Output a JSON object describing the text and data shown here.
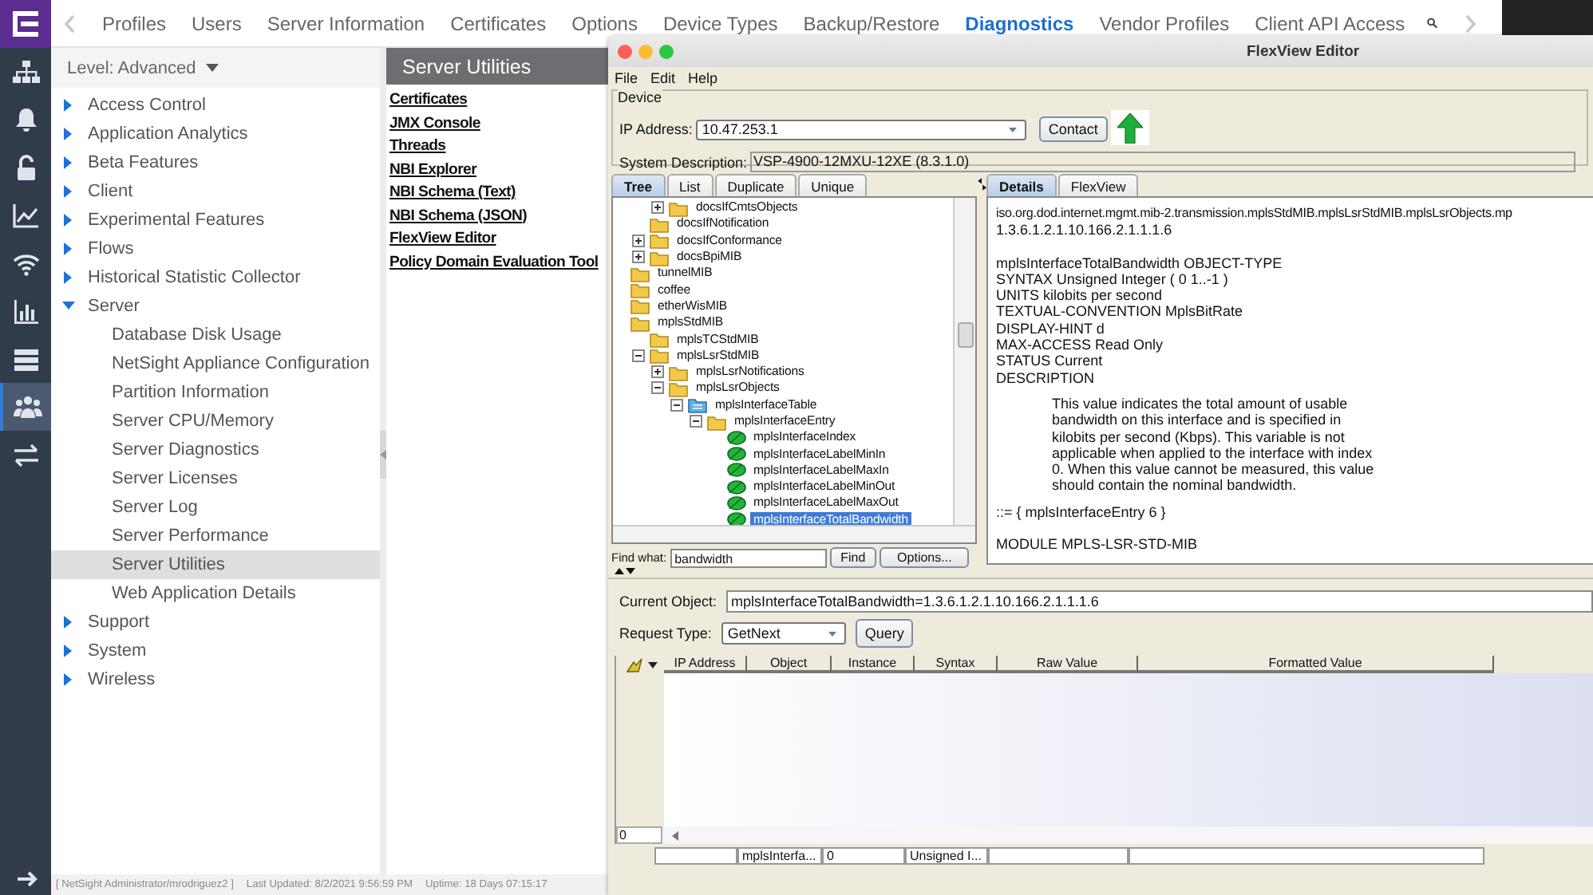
{
  "nav": {
    "items": [
      {
        "label": "Profiles",
        "selected": false
      },
      {
        "label": "Users",
        "selected": false
      },
      {
        "label": "Server Information",
        "selected": false
      },
      {
        "label": "Certificates",
        "selected": false
      },
      {
        "label": "Options",
        "selected": false
      },
      {
        "label": "Device Types",
        "selected": false
      },
      {
        "label": "Backup/Restore",
        "selected": false
      },
      {
        "label": "Diagnostics",
        "selected": true
      },
      {
        "label": "Vendor Profiles",
        "selected": false
      },
      {
        "label": "Client API Access",
        "selected": false
      }
    ]
  },
  "rail": [
    {
      "kind": "network",
      "selected": false
    },
    {
      "kind": "bell",
      "selected": false
    },
    {
      "kind": "lock",
      "selected": false
    },
    {
      "kind": "trend",
      "selected": false
    },
    {
      "kind": "wifi",
      "selected": false
    },
    {
      "kind": "bars",
      "selected": false
    },
    {
      "kind": "servers",
      "selected": false
    },
    {
      "kind": "users",
      "selected": true
    },
    {
      "kind": "exchange",
      "selected": false
    }
  ],
  "sidebar": {
    "level": "Level: Advanced",
    "items": [
      {
        "label": "Access Control",
        "expanded": false,
        "selected": false
      },
      {
        "label": "Application Analytics",
        "expanded": false,
        "selected": false
      },
      {
        "label": "Beta Features",
        "expanded": false,
        "selected": false
      },
      {
        "label": "Client",
        "expanded": false,
        "selected": false
      },
      {
        "label": "Experimental Features",
        "expanded": false,
        "selected": false
      },
      {
        "label": "Flows",
        "expanded": false,
        "selected": false
      },
      {
        "label": "Historical Statistic Collector",
        "expanded": false,
        "selected": false
      },
      {
        "label": "Server",
        "expanded": true,
        "selected": false,
        "children": [
          {
            "label": "Database Disk Usage",
            "selected": false
          },
          {
            "label": "NetSight Appliance Configuration",
            "selected": false
          },
          {
            "label": "Partition Information",
            "selected": false
          },
          {
            "label": "Server CPU/Memory",
            "selected": false
          },
          {
            "label": "Server Diagnostics",
            "selected": false
          },
          {
            "label": "Server Licenses",
            "selected": false
          },
          {
            "label": "Server Log",
            "selected": false
          },
          {
            "label": "Server Performance",
            "selected": false
          },
          {
            "label": "Server Utilities",
            "selected": true
          },
          {
            "label": "Web Application Details",
            "selected": false
          }
        ]
      },
      {
        "label": "Support",
        "expanded": false,
        "selected": false
      },
      {
        "label": "System",
        "expanded": false,
        "selected": false
      },
      {
        "label": "Wireless",
        "expanded": false,
        "selected": false
      }
    ]
  },
  "utilities": {
    "title": "Server Utilities",
    "links": [
      "Certificates",
      "JMX Console",
      "Threads",
      "NBI Explorer",
      "NBI Schema (Text)",
      "NBI Schema (JSON)",
      "FlexView Editor",
      "Policy Domain Evaluation Tool"
    ]
  },
  "status_bar": {
    "user": "[ NetSight Administrator/mrodriguez2 ]",
    "updated": "Last Updated: 8/2/2021 9:56:59 PM",
    "uptime": "Uptime: 18 Days 07:15:17"
  },
  "editor": {
    "title": "FlexView Editor",
    "menu": [
      "File",
      "Edit",
      "Help"
    ],
    "device": {
      "group": "Device",
      "ip_label": "IP Address:",
      "ip": "10.47.253.1",
      "contact": "Contact",
      "desc_label": "System Description:",
      "desc": "VSP-4900-12MXU-12XE (8.3.1.0)"
    },
    "tree_tabs": [
      {
        "label": "Tree",
        "selected": true
      },
      {
        "label": "List",
        "selected": false
      },
      {
        "label": "Duplicate",
        "selected": false
      },
      {
        "label": "Unique",
        "selected": false
      }
    ],
    "tree": [
      {
        "kind": "continuation",
        "children": [
          {
            "kind": "continuation",
            "children": [
              {
                "kind": "folder",
                "label": "docsIfCmtsObjects",
                "expanded": false,
                "selected": false
              }
            ]
          },
          {
            "kind": "folder",
            "label": "docsIfNotification",
            "selected": false
          },
          {
            "kind": "folder",
            "label": "docsIfConformance",
            "expanded": false,
            "selected": false
          },
          {
            "kind": "folder",
            "label": "docsBpiMIB",
            "expanded": false,
            "selected": false
          }
        ]
      },
      {
        "kind": "folder",
        "label": "tunnelMIB",
        "selected": false
      },
      {
        "kind": "folder",
        "label": "coffee",
        "selected": false
      },
      {
        "kind": "folder",
        "label": "etherWisMIB",
        "selected": false
      },
      {
        "kind": "folder",
        "label": "mplsStdMIB",
        "selected": false,
        "children": [
          {
            "kind": "folder",
            "label": "mplsTCStdMIB",
            "selected": false
          },
          {
            "kind": "folder",
            "label": "mplsLsrStdMIB",
            "expanded": true,
            "selected": false,
            "children": [
              {
                "kind": "folder",
                "label": "mplsLsrNotifications",
                "expanded": false,
                "selected": false
              },
              {
                "kind": "folder",
                "label": "mplsLsrObjects",
                "expanded": true,
                "selected": false,
                "children": [
                  {
                    "kind": "table",
                    "label": "mplsInterfaceTable",
                    "expanded": true,
                    "selected": false,
                    "children": [
                      {
                        "kind": "folder",
                        "label": "mplsInterfaceEntry",
                        "expanded": true,
                        "selected": false,
                        "children": [
                          {
                            "kind": "leaf",
                            "label": "mplsInterfaceIndex",
                            "selected": false
                          },
                          {
                            "kind": "leaf",
                            "label": "mplsInterfaceLabelMinIn",
                            "selected": false
                          },
                          {
                            "kind": "leaf",
                            "label": "mplsInterfaceLabelMaxIn",
                            "selected": false
                          },
                          {
                            "kind": "leaf",
                            "label": "mplsInterfaceLabelMinOut",
                            "selected": false
                          },
                          {
                            "kind": "leaf",
                            "label": "mplsInterfaceLabelMaxOut",
                            "selected": false
                          },
                          {
                            "kind": "leaf",
                            "label": "mplsInterfaceTotalBandwidth",
                            "selected": true
                          }
                        ]
                      }
                    ]
                  }
                ]
              }
            ]
          }
        ]
      }
    ],
    "find": {
      "label": "Find what:",
      "value": "bandwidth",
      "find": "Find",
      "options": "Options..."
    },
    "detail_tabs": [
      {
        "label": "Details",
        "selected": true
      },
      {
        "label": "FlexView",
        "selected": false
      }
    ],
    "details": [
      {
        "kind": "path",
        "lines": [
          "iso.org.dod.internet.mgmt.mib-2.transmission.mplsStdMIB.mplsLsrStdMIB.mplsLsrObjects.mp",
          "1.3.6.1.2.1.10.166.2.1.1.1.6"
        ]
      },
      {
        "kind": "plain",
        "lines": [
          "mplsInterfaceTotalBandwidth OBJECT-TYPE",
          "SYNTAX Unsigned Integer ( 0 1..-1 )",
          "UNITS kilobits per second",
          "TEXTUAL-CONVENTION MplsBitRate",
          "DISPLAY-HINT d",
          "MAX-ACCESS Read Only",
          "STATUS Current",
          "DESCRIPTION"
        ]
      },
      {
        "kind": "indented",
        "lines": [
          "This value indicates the total amount of usable",
          "bandwidth on this interface and is specified in",
          "kilobits per second (Kbps). This variable is not",
          "applicable when applied to the interface with index",
          "0. When this value cannot be measured, this value",
          "should contain the nominal bandwidth."
        ]
      },
      {
        "kind": "plain",
        "lines": [
          "::= { mplsInterfaceEntry 6 }"
        ]
      },
      {
        "kind": "plain",
        "lines": [
          "MODULE MPLS-LSR-STD-MIB"
        ]
      }
    ],
    "current_object": {
      "label": "Current Object:",
      "value": "mplsInterfaceTotalBandwidth=1.3.6.1.2.1.10.166.2.1.1.1.6"
    },
    "request": {
      "label": "Request Type:",
      "value": "GetNext",
      "button": "Query"
    },
    "results": {
      "columns": [
        "IP Address",
        "Object",
        "Instance",
        "Syntax",
        "Raw Value",
        "Formatted Value"
      ],
      "row_count": "0",
      "summary": [
        {
          "kind": "blank"
        },
        {
          "kind": "text",
          "text": "mplsInterfa..."
        },
        {
          "kind": "text",
          "text": "0"
        },
        {
          "kind": "text",
          "text": "Unsigned I..."
        },
        {
          "kind": "blank"
        },
        {
          "kind": "blank"
        }
      ]
    }
  }
}
